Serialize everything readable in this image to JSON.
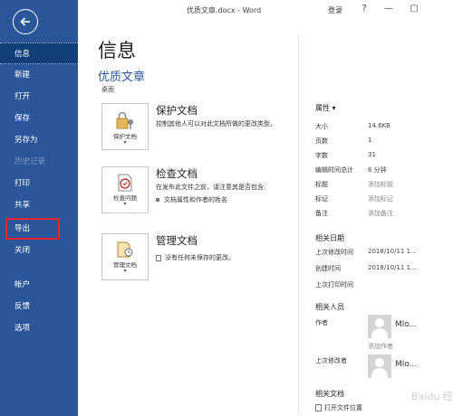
{
  "window": {
    "title": "优质文章.docx - Word",
    "login": "登录",
    "help": "?",
    "minimize": "—",
    "restore": "▢"
  },
  "sidebar": {
    "items": [
      {
        "label": "信息",
        "state": "active"
      },
      {
        "label": "新建",
        "state": "normal"
      },
      {
        "label": "打开",
        "state": "normal"
      },
      {
        "label": "保存",
        "state": "normal"
      },
      {
        "label": "另存为",
        "state": "normal"
      },
      {
        "label": "历史记录",
        "state": "disabled"
      },
      {
        "label": "打印",
        "state": "normal"
      },
      {
        "label": "共享",
        "state": "normal"
      },
      {
        "label": "导出",
        "state": "highlighted"
      },
      {
        "label": "关闭",
        "state": "normal"
      },
      {
        "label": "帐户",
        "state": "normal"
      },
      {
        "label": "反馈",
        "state": "normal"
      },
      {
        "label": "选项",
        "state": "normal"
      }
    ]
  },
  "main": {
    "title": "信息",
    "doc_name": "优质文章",
    "doc_path": "桌面",
    "actions": [
      {
        "tile_label": "保护文档",
        "title": "保护文档",
        "description": "控制其他人可以对此文档所做的更改类型。"
      },
      {
        "tile_label": "检查问题",
        "title": "检查文档",
        "description": "在发布此文件之前，请注意其是否包含:",
        "bullets": [
          "文档属性和作者的姓名"
        ]
      },
      {
        "tile_label": "管理文档",
        "title": "管理文档",
        "bullets": [
          "没有任何未保存的更改。"
        ]
      }
    ]
  },
  "properties": {
    "heading": "属性",
    "rows": [
      {
        "label": "大小",
        "value": "14.6KB"
      },
      {
        "label": "页数",
        "value": "1"
      },
      {
        "label": "字数",
        "value": "31"
      },
      {
        "label": "编辑时间总计",
        "value": "6 分钟"
      },
      {
        "label": "标题",
        "value": "添加标题"
      },
      {
        "label": "标记",
        "value": "添加标记"
      },
      {
        "label": "备注",
        "value": "添加备注"
      }
    ],
    "dates_heading": "相关日期",
    "dates": [
      {
        "label": "上次修改时间",
        "value": "2018/10/11 1..."
      },
      {
        "label": "创建时间",
        "value": "2018/10/11 1..."
      },
      {
        "label": "上次打印时间",
        "value": ""
      }
    ],
    "people_heading": "相关人员",
    "author_label": "作者",
    "author_name": "Mlo...",
    "add_author": "添加作者",
    "last_modified_by_label": "上次修改者",
    "last_modified_by_name": "Mlo...",
    "related_docs_heading": "相关文档",
    "open_file_location": "打开文件位置",
    "watermark": "Baidu 经验"
  }
}
